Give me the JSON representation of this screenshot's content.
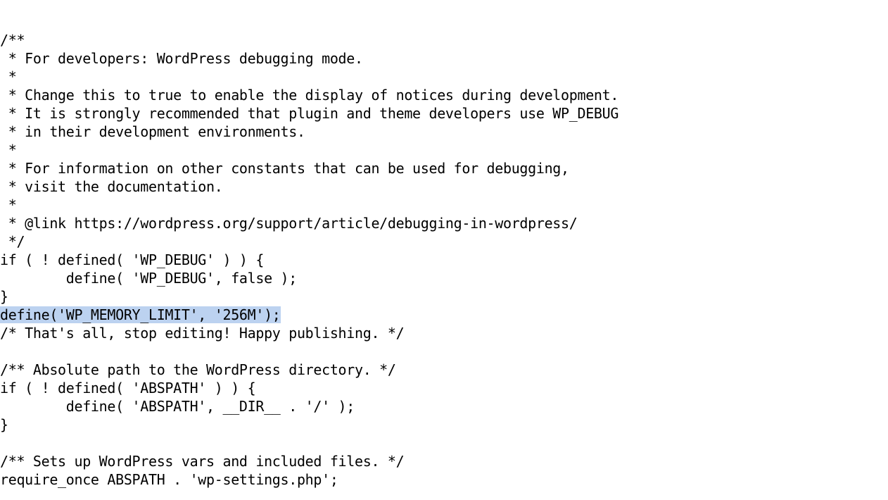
{
  "view": {
    "type": "code-editor-plain-text",
    "file_kind": "php-config",
    "background_color": "#ffffff",
    "text_color": "#000000",
    "selection_color": "#bcd2f0",
    "font_kind": "monospace",
    "font_size_px": 20,
    "line_height_px": 26
  },
  "code": {
    "lines": [
      {
        "id": "l01",
        "text": "/**",
        "highlighted": false
      },
      {
        "id": "l02",
        "text": " * For developers: WordPress debugging mode.",
        "highlighted": false
      },
      {
        "id": "l03",
        "text": " *",
        "highlighted": false
      },
      {
        "id": "l04",
        "text": " * Change this to true to enable the display of notices during development.",
        "highlighted": false
      },
      {
        "id": "l05",
        "text": " * It is strongly recommended that plugin and theme developers use WP_DEBUG",
        "highlighted": false
      },
      {
        "id": "l06",
        "text": " * in their development environments.",
        "highlighted": false
      },
      {
        "id": "l07",
        "text": " *",
        "highlighted": false
      },
      {
        "id": "l08",
        "text": " * For information on other constants that can be used for debugging,",
        "highlighted": false
      },
      {
        "id": "l09",
        "text": " * visit the documentation.",
        "highlighted": false
      },
      {
        "id": "l10",
        "text": " *",
        "highlighted": false
      },
      {
        "id": "l11",
        "text": " * @link https://wordpress.org/support/article/debugging-in-wordpress/",
        "highlighted": false
      },
      {
        "id": "l12",
        "text": " */",
        "highlighted": false
      },
      {
        "id": "l13",
        "text": "if ( ! defined( 'WP_DEBUG' ) ) {",
        "highlighted": false
      },
      {
        "id": "l14",
        "text": "        define( 'WP_DEBUG', false );",
        "highlighted": false
      },
      {
        "id": "l15",
        "text": "}",
        "highlighted": false
      },
      {
        "id": "l16",
        "text": "define('WP_MEMORY_LIMIT', '256M');",
        "highlighted": true
      },
      {
        "id": "l17",
        "text": "/* That's all, stop editing! Happy publishing. */",
        "highlighted": false
      },
      {
        "id": "l18",
        "text": "",
        "highlighted": false
      },
      {
        "id": "l19",
        "text": "/** Absolute path to the WordPress directory. */",
        "highlighted": false
      },
      {
        "id": "l20",
        "text": "if ( ! defined( 'ABSPATH' ) ) {",
        "highlighted": false
      },
      {
        "id": "l21",
        "text": "        define( 'ABSPATH', __DIR__ . '/' );",
        "highlighted": false
      },
      {
        "id": "l22",
        "text": "}",
        "highlighted": false
      },
      {
        "id": "l23",
        "text": "",
        "highlighted": false
      },
      {
        "id": "l24",
        "text": "/** Sets up WordPress vars and included files. */",
        "highlighted": false
      },
      {
        "id": "l25",
        "text": "require_once ABSPATH . 'wp-settings.php';",
        "highlighted": false
      }
    ]
  }
}
